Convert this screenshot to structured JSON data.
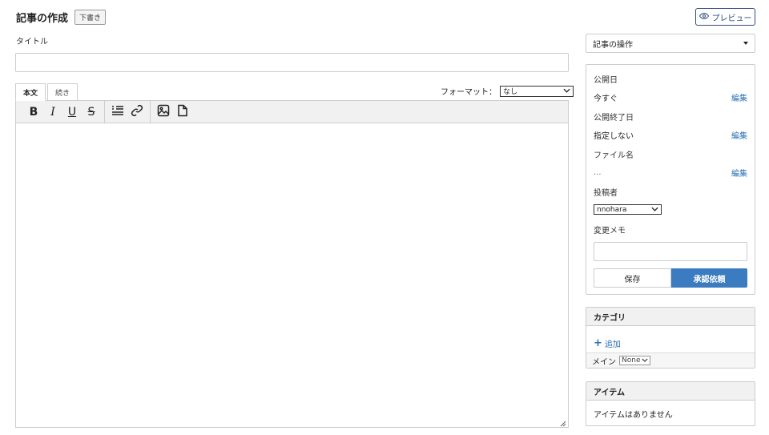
{
  "header": {
    "title": "記事の作成",
    "status_badge": "下書き"
  },
  "preview_button": {
    "label": "プレビュー"
  },
  "title_field": {
    "label": "タイトル",
    "value": ""
  },
  "editor": {
    "tabs": [
      {
        "label": "本文",
        "active": true
      },
      {
        "label": "続き",
        "active": false
      }
    ],
    "format_label": "フォーマット：",
    "format_value": "なし",
    "toolbar": {
      "bold": "B",
      "italic": "I",
      "underline": "U",
      "strike": "S"
    },
    "content": ""
  },
  "sidebar": {
    "operations_select": "記事の操作",
    "publish_panel": {
      "publish_date": {
        "label": "公開日",
        "value": "今すぐ",
        "edit": "編集"
      },
      "end_date": {
        "label": "公開終了日",
        "value": "指定しない",
        "edit": "編集"
      },
      "file_name": {
        "label": "ファイル名",
        "value": "...",
        "edit": "編集"
      },
      "author": {
        "label": "投稿者",
        "value": "nnohara"
      },
      "memo": {
        "label": "変更メモ",
        "value": ""
      },
      "save_label": "保存",
      "approve_label": "承認依頼"
    },
    "category_panel": {
      "title": "カテゴリ",
      "add_label": "追加",
      "main_label": "メイン",
      "main_value": "None"
    },
    "item_panel": {
      "title": "アイテム",
      "empty_text": "アイテムはありません"
    }
  },
  "colors": {
    "accent": "#3b7bbf",
    "link": "#2a6fb4",
    "preview_border": "#2d4a7d"
  }
}
